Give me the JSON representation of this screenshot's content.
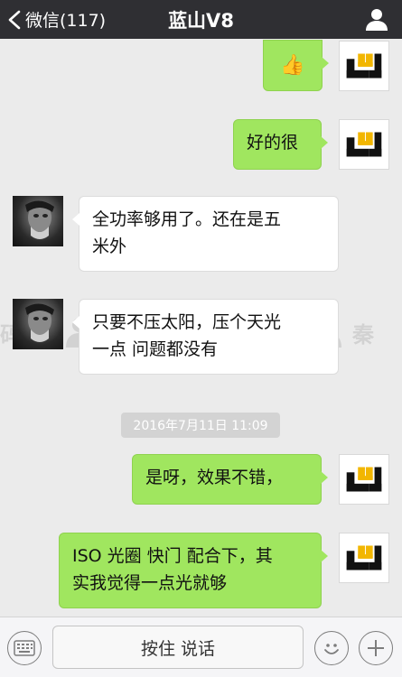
{
  "nav": {
    "back_label": "微信(117)",
    "title": "蓝山V8"
  },
  "messages": [
    {
      "from": "me",
      "type": "emoji",
      "content": "👍"
    },
    {
      "from": "me",
      "text": "好的很"
    },
    {
      "from": "other",
      "line1": "全功率够用了。还在是五",
      "line2": "米外"
    },
    {
      "from": "other",
      "line1": "只要不压太阳，压个天光",
      "line2": "一点 问题都没有"
    },
    {
      "from": "me",
      "text": "是呀，效果不错，"
    },
    {
      "from": "me",
      "line1": "ISO 光圈 快门 配合下，其",
      "line2": "实我觉得一点光就够"
    }
  ],
  "timestamp": "2016年7月11日 11:09",
  "input": {
    "hold_to_talk": "按住 说话"
  },
  "colors": {
    "nav_bg": "#2f2f33",
    "chat_bg": "#ebebeb",
    "my_bubble": "#a0e65f",
    "other_bubble": "#ffffff"
  }
}
